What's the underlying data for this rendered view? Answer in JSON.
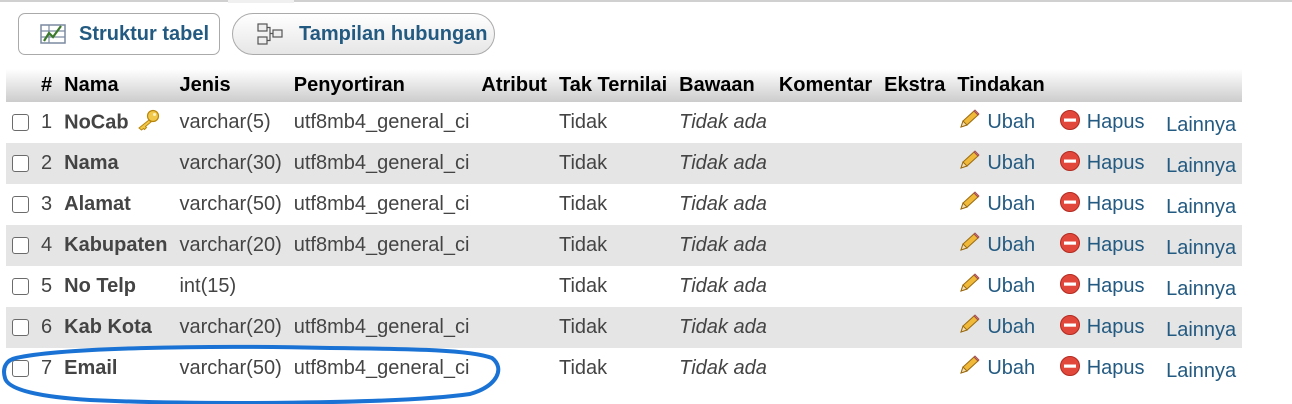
{
  "tabs": [
    {
      "label": "Struktur tabel",
      "icon": "table-structure-icon"
    },
    {
      "label": "Tampilan hubungan",
      "icon": "relation-view-icon"
    }
  ],
  "columns": [
    "#",
    "Nama",
    "Jenis",
    "Penyortiran",
    "Atribut",
    "Tak Ternilai",
    "Bawaan",
    "Komentar",
    "Ekstra",
    "Tindakan"
  ],
  "actions": {
    "edit": "Ubah",
    "drop": "Hapus",
    "more": "Lainnya"
  },
  "rows": [
    {
      "num": "1",
      "name": "NoCab",
      "type": "varchar(5)",
      "collation": "utf8mb4_general_ci",
      "attributes": "",
      "null": "Tidak",
      "default": "Tidak ada",
      "comment": "",
      "extra": "",
      "primary_key": true
    },
    {
      "num": "2",
      "name": "Nama",
      "type": "varchar(30)",
      "collation": "utf8mb4_general_ci",
      "attributes": "",
      "null": "Tidak",
      "default": "Tidak ada",
      "comment": "",
      "extra": "",
      "primary_key": false
    },
    {
      "num": "3",
      "name": "Alamat",
      "type": "varchar(50)",
      "collation": "utf8mb4_general_ci",
      "attributes": "",
      "null": "Tidak",
      "default": "Tidak ada",
      "comment": "",
      "extra": "",
      "primary_key": false
    },
    {
      "num": "4",
      "name": "Kabupaten",
      "type": "varchar(20)",
      "collation": "utf8mb4_general_ci",
      "attributes": "",
      "null": "Tidak",
      "default": "Tidak ada",
      "comment": "",
      "extra": "",
      "primary_key": false
    },
    {
      "num": "5",
      "name": "No Telp",
      "type": "int(15)",
      "collation": "",
      "attributes": "",
      "null": "Tidak",
      "default": "Tidak ada",
      "comment": "",
      "extra": "",
      "primary_key": false
    },
    {
      "num": "6",
      "name": "Kab Kota",
      "type": "varchar(20)",
      "collation": "utf8mb4_general_ci",
      "attributes": "",
      "null": "Tidak",
      "default": "Tidak ada",
      "comment": "",
      "extra": "",
      "primary_key": false
    },
    {
      "num": "7",
      "name": "Email",
      "type": "varchar(50)",
      "collation": "utf8mb4_general_ci",
      "attributes": "",
      "null": "Tidak",
      "default": "Tidak ada",
      "comment": "",
      "extra": "",
      "primary_key": false
    }
  ],
  "colors": {
    "link": "#235a81",
    "header_grad_end": "#cccccc",
    "row_alt": "#e5e5e5",
    "annotation": "#1a73d4",
    "drop_icon": "#e2473b",
    "edit_icon": "#e0a020"
  }
}
